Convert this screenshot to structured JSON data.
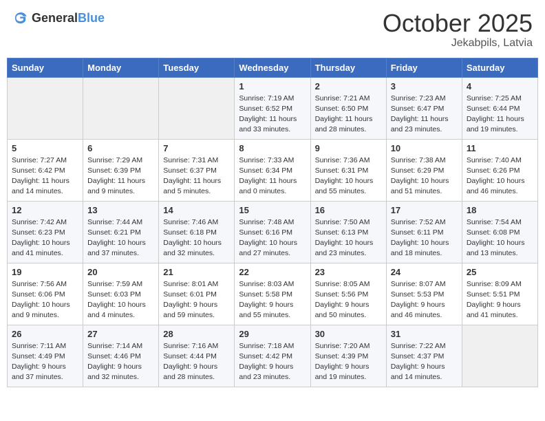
{
  "header": {
    "logo_general": "General",
    "logo_blue": "Blue",
    "month": "October 2025",
    "location": "Jekabpils, Latvia"
  },
  "weekdays": [
    "Sunday",
    "Monday",
    "Tuesday",
    "Wednesday",
    "Thursday",
    "Friday",
    "Saturday"
  ],
  "weeks": [
    [
      {
        "day": "",
        "info": ""
      },
      {
        "day": "",
        "info": ""
      },
      {
        "day": "",
        "info": ""
      },
      {
        "day": "1",
        "info": "Sunrise: 7:19 AM\nSunset: 6:52 PM\nDaylight: 11 hours\nand 33 minutes."
      },
      {
        "day": "2",
        "info": "Sunrise: 7:21 AM\nSunset: 6:50 PM\nDaylight: 11 hours\nand 28 minutes."
      },
      {
        "day": "3",
        "info": "Sunrise: 7:23 AM\nSunset: 6:47 PM\nDaylight: 11 hours\nand 23 minutes."
      },
      {
        "day": "4",
        "info": "Sunrise: 7:25 AM\nSunset: 6:44 PM\nDaylight: 11 hours\nand 19 minutes."
      }
    ],
    [
      {
        "day": "5",
        "info": "Sunrise: 7:27 AM\nSunset: 6:42 PM\nDaylight: 11 hours\nand 14 minutes."
      },
      {
        "day": "6",
        "info": "Sunrise: 7:29 AM\nSunset: 6:39 PM\nDaylight: 11 hours\nand 9 minutes."
      },
      {
        "day": "7",
        "info": "Sunrise: 7:31 AM\nSunset: 6:37 PM\nDaylight: 11 hours\nand 5 minutes."
      },
      {
        "day": "8",
        "info": "Sunrise: 7:33 AM\nSunset: 6:34 PM\nDaylight: 11 hours\nand 0 minutes."
      },
      {
        "day": "9",
        "info": "Sunrise: 7:36 AM\nSunset: 6:31 PM\nDaylight: 10 hours\nand 55 minutes."
      },
      {
        "day": "10",
        "info": "Sunrise: 7:38 AM\nSunset: 6:29 PM\nDaylight: 10 hours\nand 51 minutes."
      },
      {
        "day": "11",
        "info": "Sunrise: 7:40 AM\nSunset: 6:26 PM\nDaylight: 10 hours\nand 46 minutes."
      }
    ],
    [
      {
        "day": "12",
        "info": "Sunrise: 7:42 AM\nSunset: 6:23 PM\nDaylight: 10 hours\nand 41 minutes."
      },
      {
        "day": "13",
        "info": "Sunrise: 7:44 AM\nSunset: 6:21 PM\nDaylight: 10 hours\nand 37 minutes."
      },
      {
        "day": "14",
        "info": "Sunrise: 7:46 AM\nSunset: 6:18 PM\nDaylight: 10 hours\nand 32 minutes."
      },
      {
        "day": "15",
        "info": "Sunrise: 7:48 AM\nSunset: 6:16 PM\nDaylight: 10 hours\nand 27 minutes."
      },
      {
        "day": "16",
        "info": "Sunrise: 7:50 AM\nSunset: 6:13 PM\nDaylight: 10 hours\nand 23 minutes."
      },
      {
        "day": "17",
        "info": "Sunrise: 7:52 AM\nSunset: 6:11 PM\nDaylight: 10 hours\nand 18 minutes."
      },
      {
        "day": "18",
        "info": "Sunrise: 7:54 AM\nSunset: 6:08 PM\nDaylight: 10 hours\nand 13 minutes."
      }
    ],
    [
      {
        "day": "19",
        "info": "Sunrise: 7:56 AM\nSunset: 6:06 PM\nDaylight: 10 hours\nand 9 minutes."
      },
      {
        "day": "20",
        "info": "Sunrise: 7:59 AM\nSunset: 6:03 PM\nDaylight: 10 hours\nand 4 minutes."
      },
      {
        "day": "21",
        "info": "Sunrise: 8:01 AM\nSunset: 6:01 PM\nDaylight: 9 hours\nand 59 minutes."
      },
      {
        "day": "22",
        "info": "Sunrise: 8:03 AM\nSunset: 5:58 PM\nDaylight: 9 hours\nand 55 minutes."
      },
      {
        "day": "23",
        "info": "Sunrise: 8:05 AM\nSunset: 5:56 PM\nDaylight: 9 hours\nand 50 minutes."
      },
      {
        "day": "24",
        "info": "Sunrise: 8:07 AM\nSunset: 5:53 PM\nDaylight: 9 hours\nand 46 minutes."
      },
      {
        "day": "25",
        "info": "Sunrise: 8:09 AM\nSunset: 5:51 PM\nDaylight: 9 hours\nand 41 minutes."
      }
    ],
    [
      {
        "day": "26",
        "info": "Sunrise: 7:11 AM\nSunset: 4:49 PM\nDaylight: 9 hours\nand 37 minutes."
      },
      {
        "day": "27",
        "info": "Sunrise: 7:14 AM\nSunset: 4:46 PM\nDaylight: 9 hours\nand 32 minutes."
      },
      {
        "day": "28",
        "info": "Sunrise: 7:16 AM\nSunset: 4:44 PM\nDaylight: 9 hours\nand 28 minutes."
      },
      {
        "day": "29",
        "info": "Sunrise: 7:18 AM\nSunset: 4:42 PM\nDaylight: 9 hours\nand 23 minutes."
      },
      {
        "day": "30",
        "info": "Sunrise: 7:20 AM\nSunset: 4:39 PM\nDaylight: 9 hours\nand 19 minutes."
      },
      {
        "day": "31",
        "info": "Sunrise: 7:22 AM\nSunset: 4:37 PM\nDaylight: 9 hours\nand 14 minutes."
      },
      {
        "day": "",
        "info": ""
      }
    ]
  ]
}
